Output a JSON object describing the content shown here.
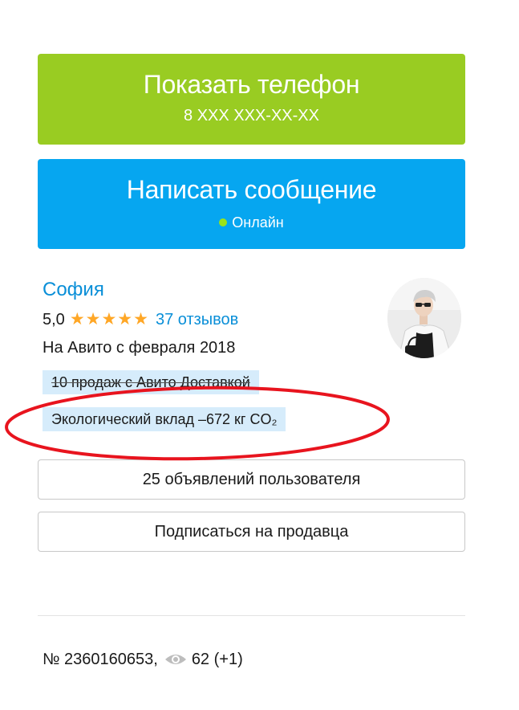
{
  "phone_button": {
    "title": "Показать телефон",
    "number": "8 XXX XXX-XX-XX",
    "color": "#99cc22"
  },
  "message_button": {
    "title": "Написать сообщение",
    "status": "Онлайн",
    "color": "#06a6f0"
  },
  "seller": {
    "name": "София",
    "rating": "5,0",
    "stars": 5,
    "stars_display": "★★★★★",
    "reviews": "37 отзывов",
    "since": "На Авито с февраля 2018",
    "avatar_icon": "user-photo"
  },
  "badges": {
    "delivery": "10 продаж с Авито Доставкой",
    "eco": "Экологический вклад –672 кг CO₂"
  },
  "listings_button": "25 объявлений пользователя",
  "subscribe_button": "Подписаться на продавца",
  "footer": {
    "ad_number": "№ 2360160653,",
    "views": "62 (+1)",
    "views_icon": "eye-icon"
  },
  "colors": {
    "link": "#0a8fd8",
    "star": "#ffa726",
    "badge_bg": "#d6ecfb",
    "annotation": "#e8141e",
    "online": "#9be31a"
  }
}
